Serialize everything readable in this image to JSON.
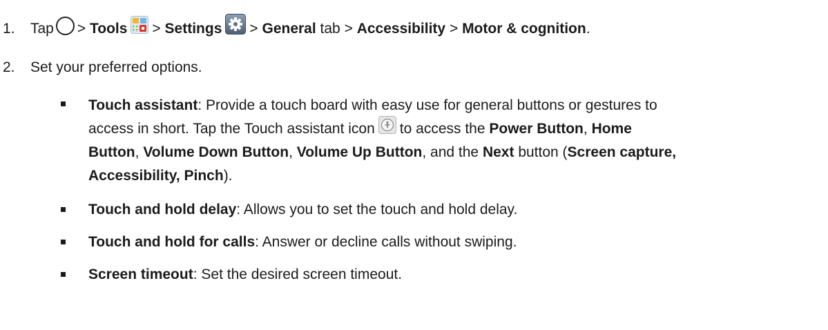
{
  "steps": [
    {
      "number": "1.",
      "tap": "Tap",
      "sep1": ">",
      "tools": "Tools",
      "sep2": ">",
      "settings": "Settings",
      "sep3": ">",
      "general": "General",
      "tab_word": "tab",
      "sep4": ">",
      "accessibility": "Accessibility",
      "sep5": ">",
      "motor": "Motor & cognition",
      "end": ".",
      "icons": [
        "home-circle",
        "tools-app",
        "settings-gear"
      ]
    },
    {
      "number": "2.",
      "text": "Set your preferred options."
    }
  ],
  "options": [
    {
      "title": "Touch assistant",
      "line1_rest": ": Provide a touch board with easy use for general buttons or gestures to",
      "line2_pre": "access in short. Tap the Touch assistant icon",
      "line2_mid": "to access the",
      "power": "Power Button",
      "comma1": ",",
      "home": "Home",
      "button_word": "Button",
      "comma2": ",",
      "voldown": "Volume Down Button",
      "comma3": ",",
      "volup": "Volume Up Button",
      "and_the": ", and the",
      "next": "Next",
      "button_open": "button (",
      "screen_capture": "Screen capture,",
      "line4_bold": "Accessibility, Pinch",
      "line4_end": ").",
      "icon": "touch-assistant"
    },
    {
      "title": "Touch and hold delay",
      "rest": ": Allows you to set the touch and hold delay."
    },
    {
      "title": "Touch and hold for calls",
      "rest": ": Answer or decline calls without swiping."
    },
    {
      "title": "Screen timeout",
      "rest": ": Set the desired screen timeout."
    }
  ]
}
